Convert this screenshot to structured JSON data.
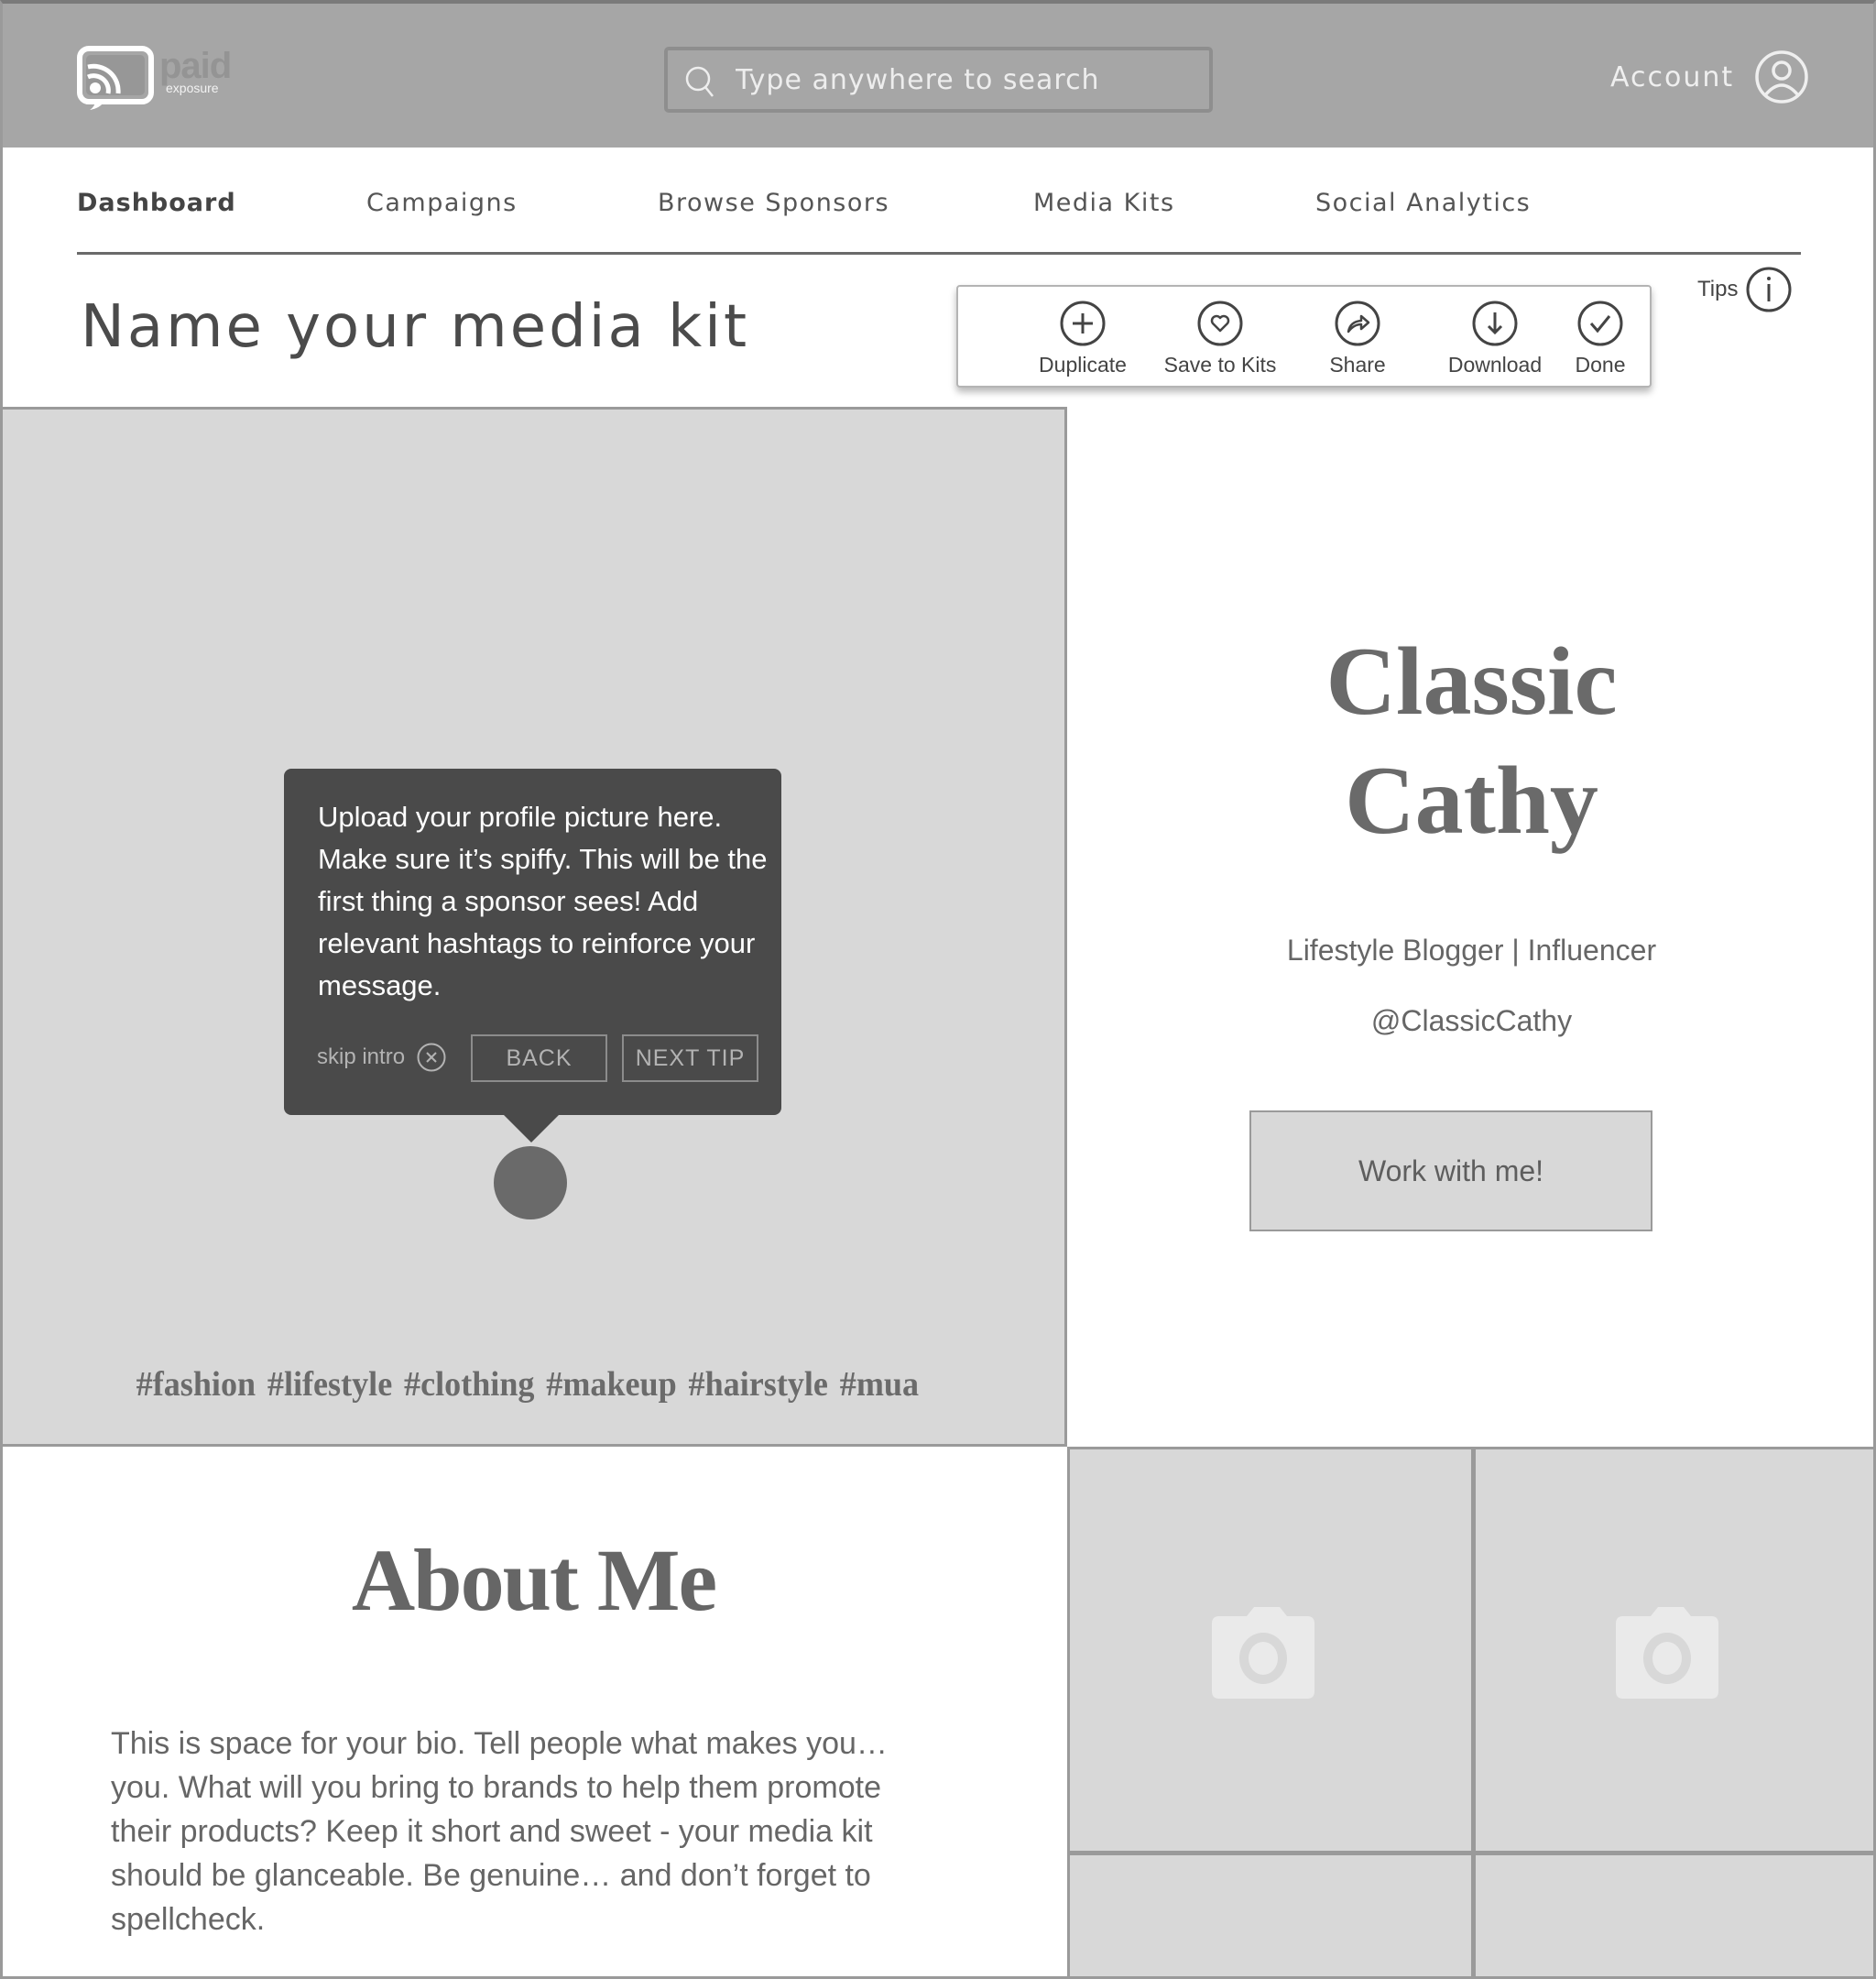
{
  "header": {
    "logo": {
      "word": "paid",
      "sub": "exposure",
      "icon": "logo-icon"
    },
    "search": {
      "placeholder": "Type anywhere to search",
      "value": "",
      "icon": "search-icon"
    },
    "account": {
      "label": "Account",
      "icon": "user-circle-icon"
    }
  },
  "nav": {
    "items": [
      {
        "label": "Dashboard",
        "active": true
      },
      {
        "label": "Campaigns",
        "active": false
      },
      {
        "label": "Browse Sponsors",
        "active": false
      },
      {
        "label": "Media Kits",
        "active": false
      },
      {
        "label": "Social Analytics",
        "active": false
      }
    ]
  },
  "page": {
    "title": "Name your media kit"
  },
  "toolbar": {
    "actions": [
      {
        "label": "Duplicate",
        "icon": "plus-circle-icon"
      },
      {
        "label": "Save to Kits",
        "icon": "heart-circle-icon"
      },
      {
        "label": "Share",
        "icon": "share-circle-icon"
      },
      {
        "label": "Download",
        "icon": "download-circle-icon"
      },
      {
        "label": "Done",
        "icon": "check-circle-icon"
      }
    ]
  },
  "tips": {
    "label": "Tips",
    "icon": "info-icon"
  },
  "hero": {
    "tooltip": {
      "text": "Upload your profile picture here. Make sure it’s spiffy. This will be the first thing a sponsor sees! Add relevant hashtags to reinforce your message.",
      "skip_label": "skip intro",
      "back_label": "BACK",
      "next_label": "NEXT TIP"
    },
    "hashtags": "#fashion #lifestyle #clothing #makeup #hairstyle #mua"
  },
  "profile": {
    "name_line1": "Classic",
    "name_line2": "Cathy",
    "role": "Lifestyle Blogger | Influencer",
    "handle": "@ClassicCathy",
    "cta_label": "Work with me!"
  },
  "about": {
    "title": "About Me",
    "bio": "This is space for your bio. Tell people what makes you… you. What will you bring to brands to help them promote their products? Keep it short and sweet - your media kit should be glanceable. Be genuine… and don’t forget to spellcheck."
  },
  "colors": {
    "header_bg": "#a6a6a6",
    "placeholder_bg": "#d8d8d8",
    "tooltip_bg": "#4a4a4a",
    "text_dark": "#4a4a4a",
    "text_muted": "#666666"
  }
}
